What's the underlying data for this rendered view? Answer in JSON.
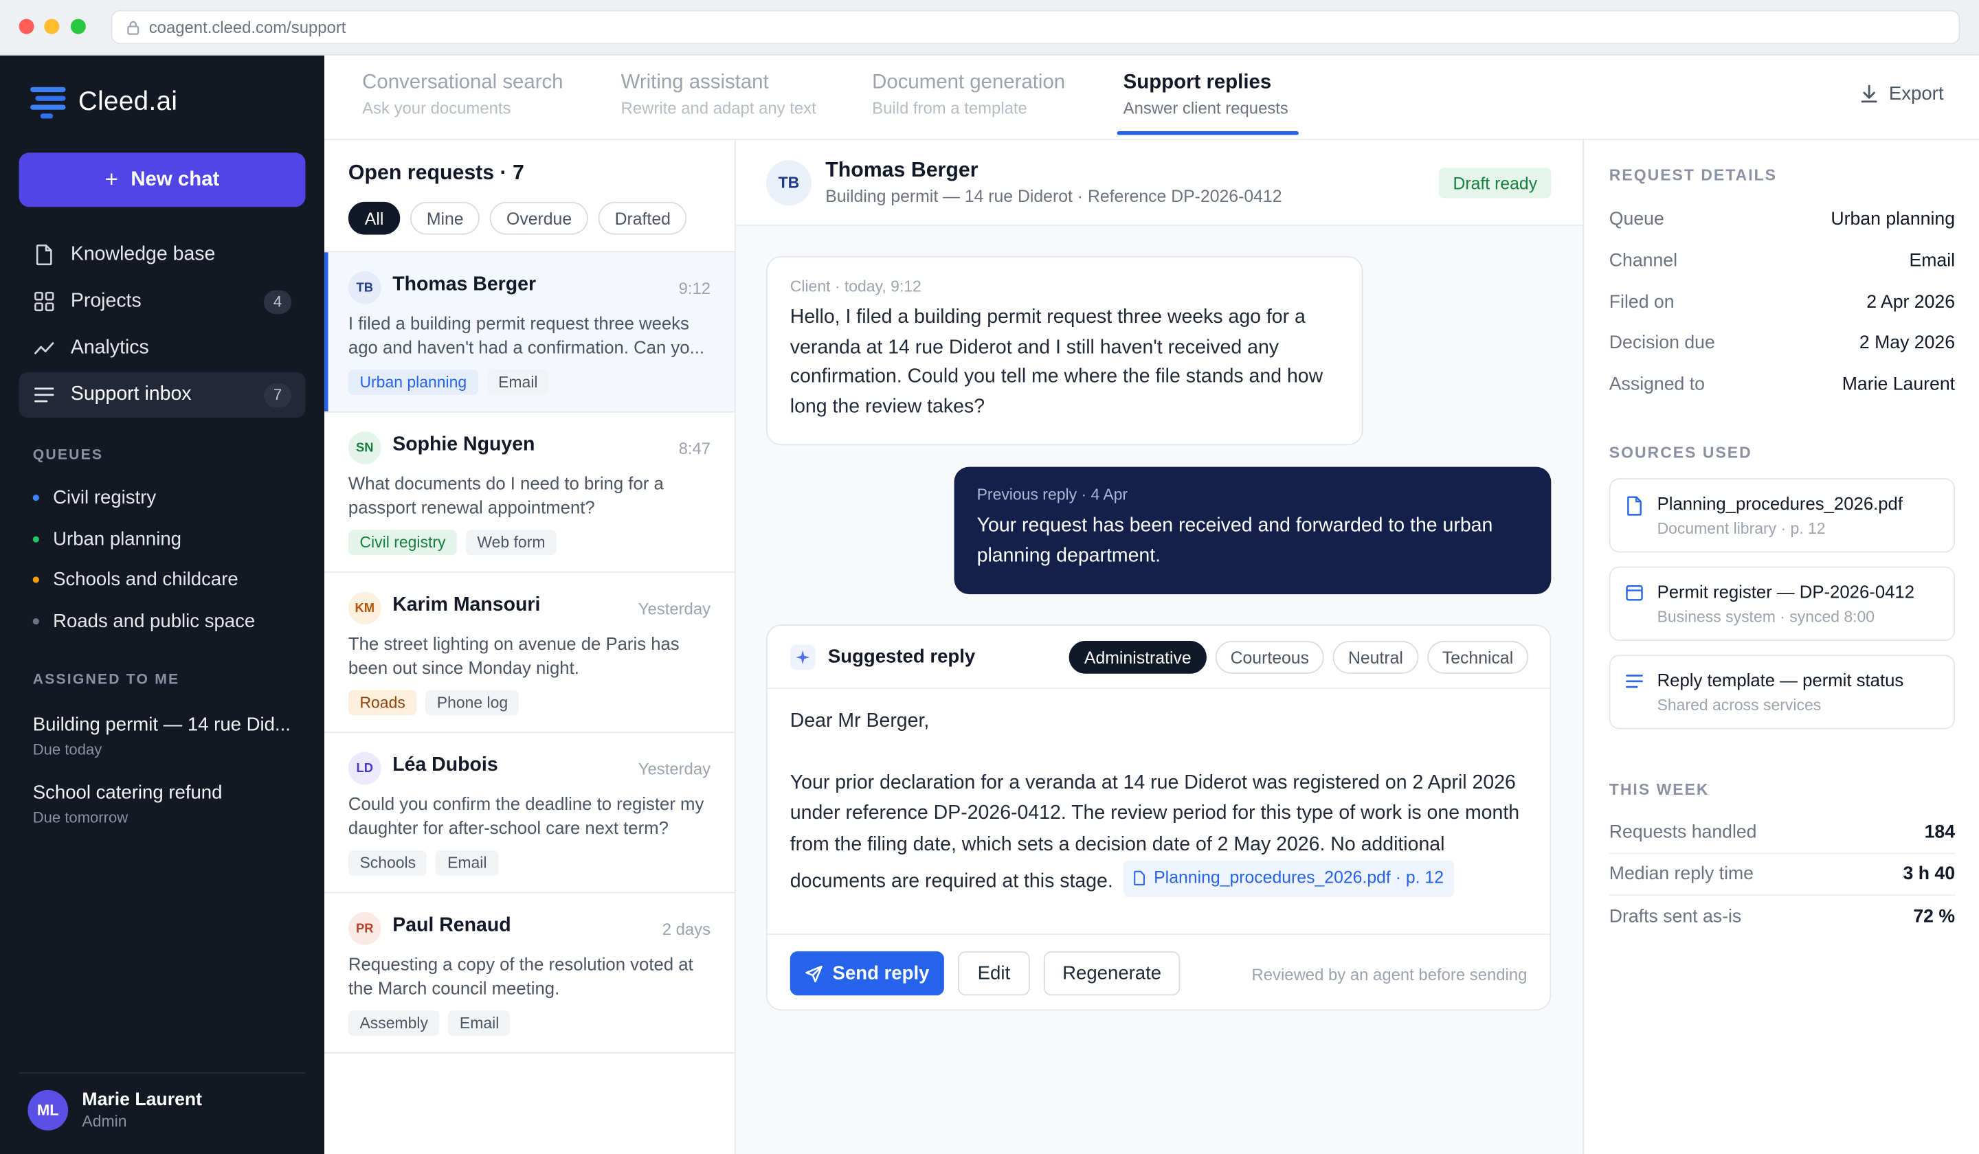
{
  "browser": {
    "url": "coagent.cleed.com/support"
  },
  "brand": {
    "name": "Cleed.ai"
  },
  "sidebar": {
    "new_chat": "New chat",
    "nav": [
      {
        "label": "Knowledge base",
        "badge": "",
        "icon": "document-icon"
      },
      {
        "label": "Projects",
        "badge": "4",
        "icon": "grid-icon"
      },
      {
        "label": "Analytics",
        "badge": "",
        "icon": "analytics-icon"
      },
      {
        "label": "Support inbox",
        "badge": "7",
        "icon": "inbox-icon"
      }
    ],
    "queues_title": "QUEUES",
    "queues": [
      {
        "label": "Civil registry",
        "color": "#3b82f6"
      },
      {
        "label": "Urban planning",
        "color": "#22c55e"
      },
      {
        "label": "Schools and childcare",
        "color": "#f59e0b"
      },
      {
        "label": "Roads and public space",
        "color": "#6b7280"
      }
    ],
    "assigned_title": "ASSIGNED TO ME",
    "assigned": [
      {
        "title": "Building permit — 14 rue Did...",
        "due": "Due today"
      },
      {
        "title": "School catering refund",
        "due": "Due tomorrow"
      }
    ],
    "user": {
      "initials": "ML",
      "name": "Marie Laurent",
      "role": "Admin"
    }
  },
  "tabs": [
    {
      "label": "Conversational search",
      "sub": "Ask your documents"
    },
    {
      "label": "Writing assistant",
      "sub": "Rewrite and adapt any text"
    },
    {
      "label": "Document generation",
      "sub": "Build from a template"
    },
    {
      "label": "Support replies",
      "sub": "Answer client requests"
    }
  ],
  "export_label": "Export",
  "requests": {
    "title": "Open requests · 7",
    "filters": [
      "All",
      "Mine",
      "Overdue",
      "Drafted"
    ],
    "items": [
      {
        "initials": "TB",
        "name": "Thomas Berger",
        "time": "9:12",
        "preview": "I filed a building permit request three weeks ago and haven't had a confirmation. Can yo...",
        "tags": [
          "Urban planning",
          "Email"
        ]
      },
      {
        "initials": "SN",
        "name": "Sophie Nguyen",
        "time": "8:47",
        "preview": "What documents do I need to bring for a passport renewal appointment?",
        "tags": [
          "Civil registry",
          "Web form"
        ]
      },
      {
        "initials": "KM",
        "name": "Karim Mansouri",
        "time": "Yesterday",
        "preview": "The street lighting on avenue de Paris has been out since Monday night.",
        "tags": [
          "Roads",
          "Phone log"
        ]
      },
      {
        "initials": "LD",
        "name": "Léa Dubois",
        "time": "Yesterday",
        "preview": "Could you confirm the deadline to register my daughter for after-school care next term?",
        "tags": [
          "Schools",
          "Email"
        ]
      },
      {
        "initials": "PR",
        "name": "Paul Renaud",
        "time": "2 days",
        "preview": "Requesting a copy of the resolution voted at the March council meeting.",
        "tags": [
          "Assembly",
          "Email"
        ]
      }
    ]
  },
  "conversation": {
    "initials": "TB",
    "name": "Thomas Berger",
    "subtitle": "Building permit — 14 rue Diderot · Reference DP-2026-0412",
    "status": "Draft ready",
    "client_meta": "Client · today, 9:12",
    "client_text": "Hello, I filed a building permit request three weeks ago for a veranda at 14 rue Diderot and I still haven't received any confirmation. Could you tell me where the file stands and how long the review takes?",
    "prev_meta": "Previous reply · 4 Apr",
    "prev_text": "Your request has been received and forwarded to the urban planning department.",
    "suggest_title": "Suggested reply",
    "tones": [
      "Administrative",
      "Courteous",
      "Neutral",
      "Technical"
    ],
    "reply_greeting": "Dear Mr Berger,",
    "reply_body": "Your prior declaration for a veranda at 14 rue Diderot was registered on 2 April 2026 under reference DP-2026-0412. The review period for this type of work is one month from the filing date, which sets a decision date of 2 May 2026. No additional documents are required at this stage.",
    "citation": "Planning_procedures_2026.pdf · p. 12",
    "send_label": "Send reply",
    "edit_label": "Edit",
    "regen_label": "Regenerate",
    "review_note": "Reviewed by an agent before sending"
  },
  "details": {
    "title": "REQUEST DETAILS",
    "rows": [
      {
        "k": "Queue",
        "v": "Urban planning"
      },
      {
        "k": "Channel",
        "v": "Email"
      },
      {
        "k": "Filed on",
        "v": "2 Apr 2026"
      },
      {
        "k": "Decision due",
        "v": "2 May 2026"
      },
      {
        "k": "Assigned to",
        "v": "Marie Laurent"
      }
    ],
    "sources_title": "SOURCES USED",
    "sources": [
      {
        "title": "Planning_procedures_2026.pdf",
        "sub": "Document library · p. 12",
        "icon": "file-icon"
      },
      {
        "title": "Permit register — DP-2026-0412",
        "sub": "Business system · synced 8:00",
        "icon": "database-icon"
      },
      {
        "title": "Reply template — permit status",
        "sub": "Shared across services",
        "icon": "template-icon"
      }
    ],
    "week_title": "THIS WEEK",
    "stats": [
      {
        "k": "Requests handled",
        "v": "184"
      },
      {
        "k": "Median reply time",
        "v": "3 h 40"
      },
      {
        "k": "Drafts sent as-is",
        "v": "72 %"
      }
    ]
  }
}
